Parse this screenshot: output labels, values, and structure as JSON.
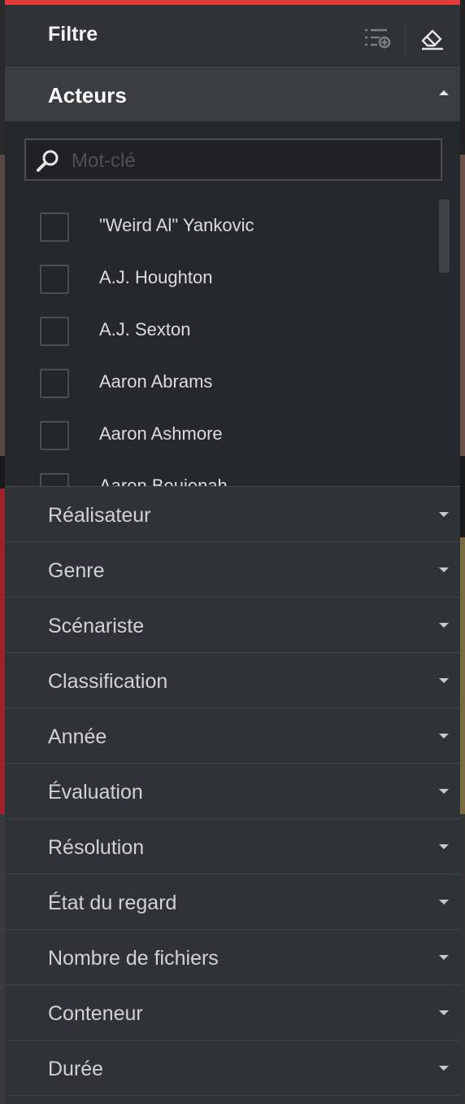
{
  "panel": {
    "title": "Filtre",
    "accent_color": "#e33b3b",
    "icons": {
      "add_filter": "list-add-icon",
      "clear": "eraser-icon"
    }
  },
  "actors": {
    "label": "Acteurs",
    "search_placeholder": "Mot-clé",
    "search_value": "",
    "items": [
      {
        "name": "\"Weird Al\" Yankovic",
        "checked": false
      },
      {
        "name": "A.J. Houghton",
        "checked": false
      },
      {
        "name": "A.J. Sexton",
        "checked": false
      },
      {
        "name": "Aaron Abrams",
        "checked": false
      },
      {
        "name": "Aaron Ashmore",
        "checked": false
      },
      {
        "name": "Aaron Beuienah",
        "checked": false
      }
    ]
  },
  "sections": [
    {
      "label": "Réalisateur"
    },
    {
      "label": "Genre"
    },
    {
      "label": "Scénariste"
    },
    {
      "label": "Classification"
    },
    {
      "label": "Année"
    },
    {
      "label": "Évaluation"
    },
    {
      "label": "Résolution"
    },
    {
      "label": "État du regard"
    },
    {
      "label": "Nombre de fichiers"
    },
    {
      "label": "Conteneur"
    },
    {
      "label": "Durée"
    }
  ]
}
